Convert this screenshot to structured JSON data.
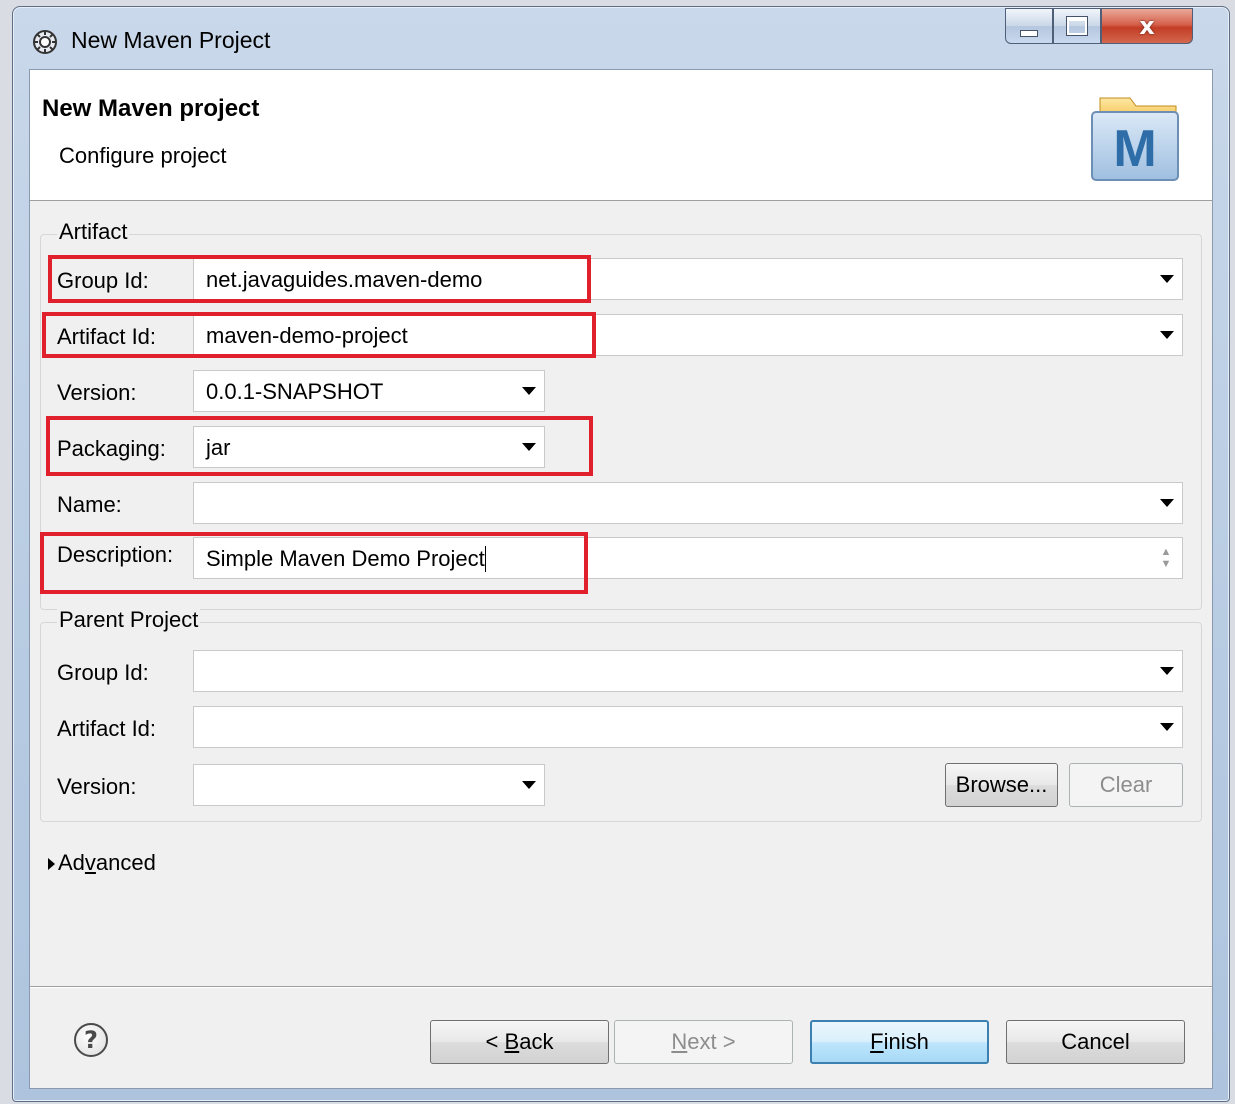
{
  "window": {
    "title": "New Maven Project"
  },
  "banner": {
    "title": "New Maven project",
    "subtitle": "Configure project"
  },
  "artifact": {
    "label": "Artifact",
    "group_id_label": "Group Id:",
    "group_id_value": "net.javaguides.maven-demo",
    "artifact_id_label": "Artifact Id:",
    "artifact_id_value": "maven-demo-project",
    "version_label": "Version:",
    "version_value": "0.0.1-SNAPSHOT",
    "packaging_label": "Packaging:",
    "packaging_value": "jar",
    "name_label": "Name:",
    "name_value": "",
    "description_label": "Description:",
    "description_value": "Simple Maven Demo Project"
  },
  "parent": {
    "label": "Parent Project",
    "group_id_label": "Group Id:",
    "group_id_value": "",
    "artifact_id_label": "Artifact Id:",
    "artifact_id_value": "",
    "version_label": "Version:",
    "version_value": "",
    "browse_label": "Browse...",
    "clear_label": "Clear"
  },
  "advanced": {
    "label_pre": "Ad",
    "label_accel": "v",
    "label_post": "anced"
  },
  "footer": {
    "back_pre": "< ",
    "back_accel": "B",
    "back_post": "ack",
    "next_accel": "N",
    "next_post": "ext >",
    "finish_accel": "F",
    "finish_post": "inish",
    "cancel_label": "Cancel",
    "help_glyph": "?"
  },
  "colors": {
    "highlight": "#e0202c",
    "default_button": "#3c7fb1"
  },
  "icons": [
    "app-gear-icon",
    "minimize-icon",
    "maximize-icon",
    "close-icon",
    "maven-logo-icon",
    "dropdown-arrow-icon",
    "spinner-icon",
    "expand-triangle-icon",
    "help-icon"
  ]
}
